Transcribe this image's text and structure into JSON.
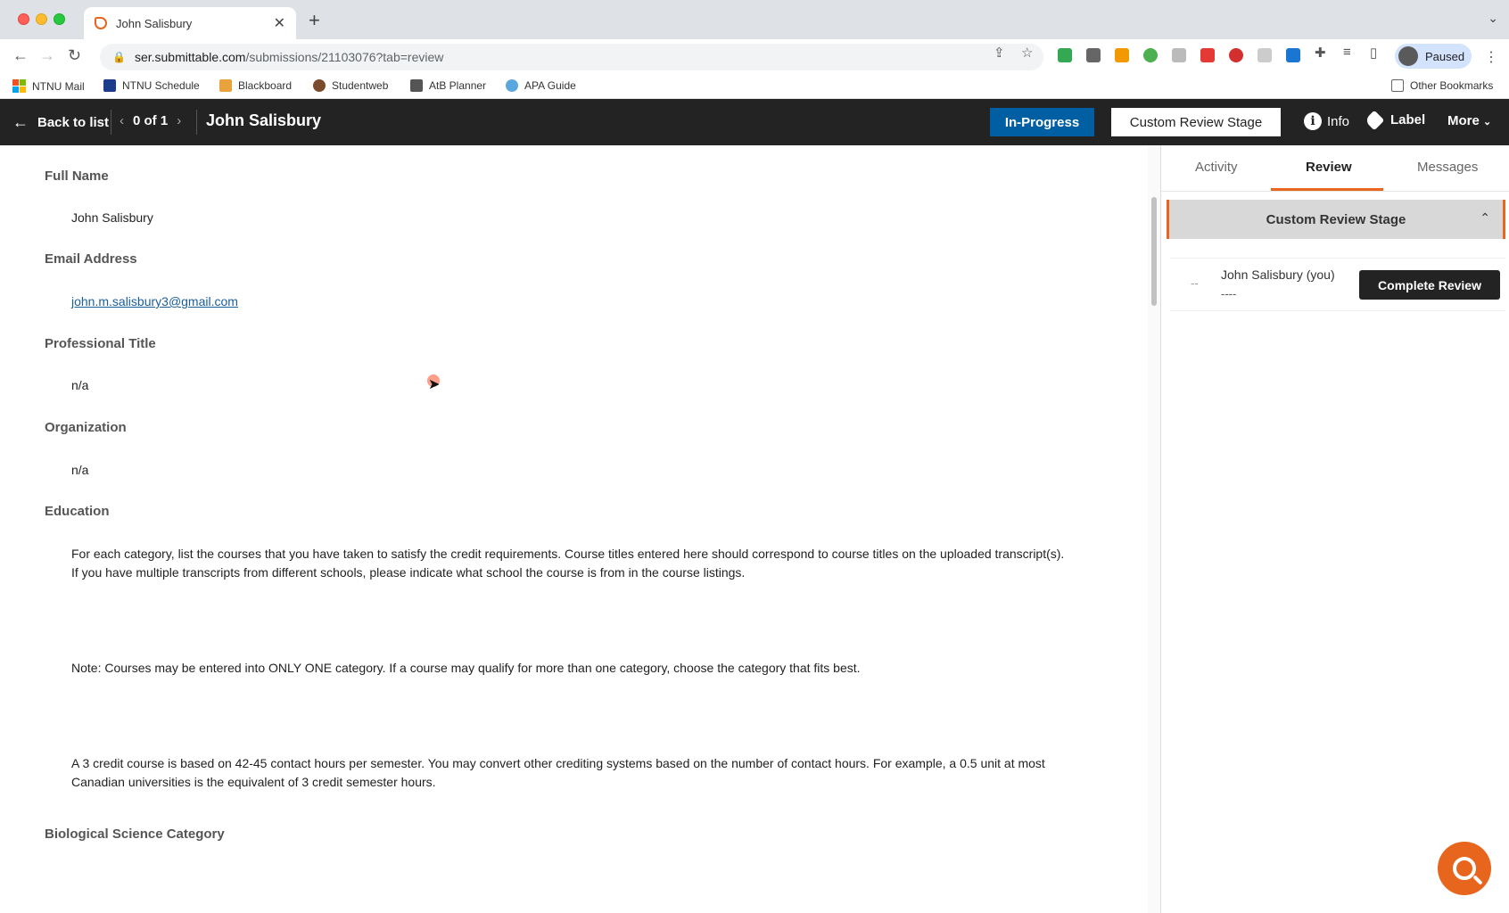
{
  "browser": {
    "tab_title": "John Salisbury",
    "url_host": "ser.submittable.com",
    "url_path": "/submissions/21103076?tab=review",
    "profile_status": "Paused",
    "bookmarks": [
      "NTNU Mail",
      "NTNU Schedule",
      "Blackboard",
      "Studentweb",
      "AtB Planner",
      "APA Guide"
    ],
    "other_bookmarks": "Other Bookmarks"
  },
  "header": {
    "back_label": "Back to list",
    "pager_label": "0 of 1",
    "submitter_name": "John Salisbury",
    "status_button": "In-Progress",
    "stage_button": "Custom Review Stage",
    "info_label": "Info",
    "label_label": "Label",
    "more_label": "More"
  },
  "form": {
    "full_name_label": "Full Name",
    "full_name_value": "John Salisbury",
    "email_label": "Email Address",
    "email_value": "john.m.salisbury3@gmail.com",
    "title_label": "Professional Title",
    "title_value": "n/a",
    "org_label": "Organization",
    "org_value": "n/a",
    "education_label": "Education",
    "education_para1": "For each category, list the courses that you have taken to satisfy the credit requirements.  Course titles entered here should correspond to course titles on the uploaded transcript(s).  If you have multiple transcripts from different schools, please indicate what school the course is from in the course listings.",
    "education_para2": "Note: Courses may be entered into ONLY ONE category. If a course may qualify for more than one category, choose the category that fits best.",
    "education_para3": "A 3 credit course is based on 42-45 contact hours per semester.  You may convert other crediting systems based on the number of contact hours.  For example, a 0.5 unit at most Canadian universities is the equivalent of 3 credit semester hours.",
    "bio_category_label": "Biological Science Category"
  },
  "sidebar": {
    "tabs": [
      "Activity",
      "Review",
      "Messages"
    ],
    "active_tab": "Review",
    "stage_title": "Custom Review Stage",
    "reviewer_dash": "--",
    "reviewer_name": "John Salisbury (you)",
    "reviewer_score": "----",
    "complete_button": "Complete Review"
  },
  "colors": {
    "accent": "#e8651d",
    "header_bg": "#232323",
    "status_blue": "#005ea2"
  }
}
